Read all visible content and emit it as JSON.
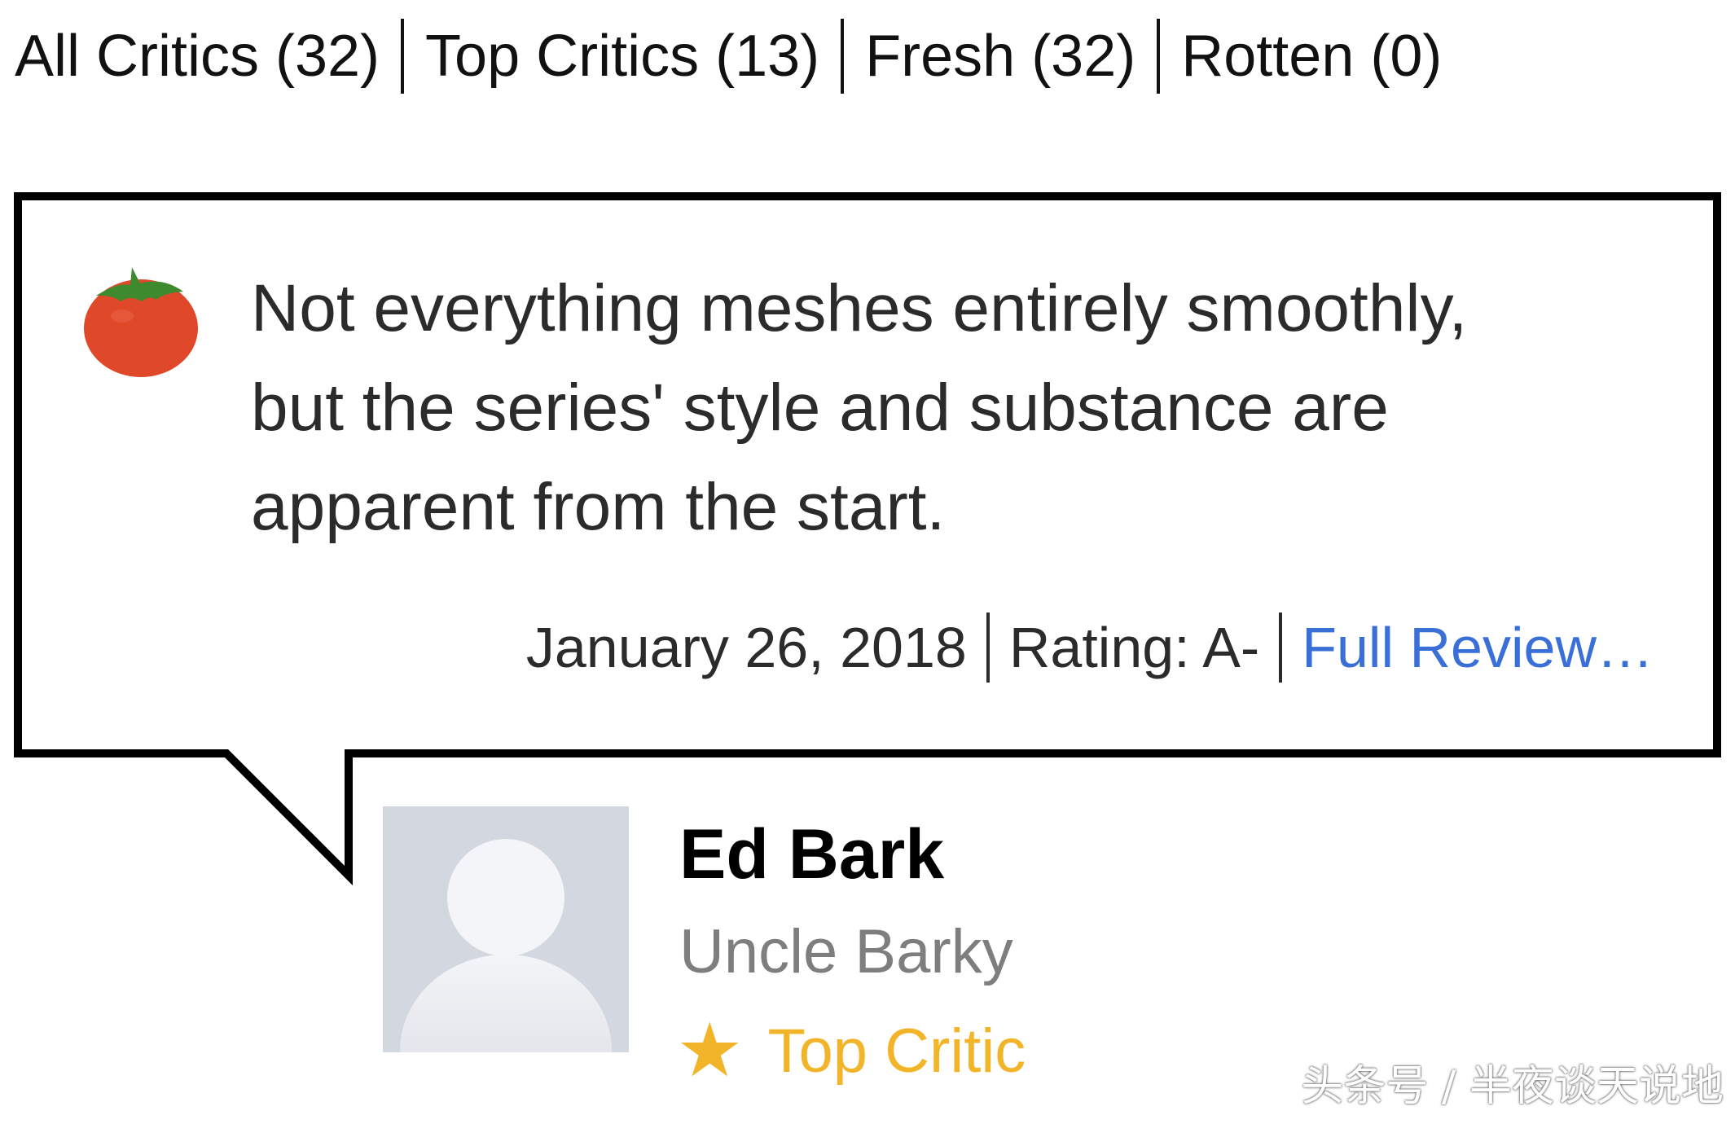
{
  "filters": {
    "all_critics": "All Critics (32)",
    "top_critics": "Top Critics (13)",
    "fresh": "Fresh (32)",
    "rotten": "Rotten (0)"
  },
  "review": {
    "icon": "tomato-icon",
    "quote_lines": [
      "Not everything meshes entirely smoothly,",
      "but the series' style and substance are",
      "apparent from the start."
    ],
    "date": "January 26, 2018",
    "rating": "Rating: A-",
    "full_review_label": "Full Review…"
  },
  "critic": {
    "name": "Ed Bark",
    "publication": "Uncle Barky",
    "badge_label": "Top Critic",
    "badge_icon": "star-icon"
  },
  "watermark": "头条号 / 半夜谈天说地",
  "colors": {
    "link": "#3a6fd8",
    "top_critic": "#f2b52a",
    "tomato": "#e0482a",
    "avatar_bg": "#d3d7e0"
  }
}
